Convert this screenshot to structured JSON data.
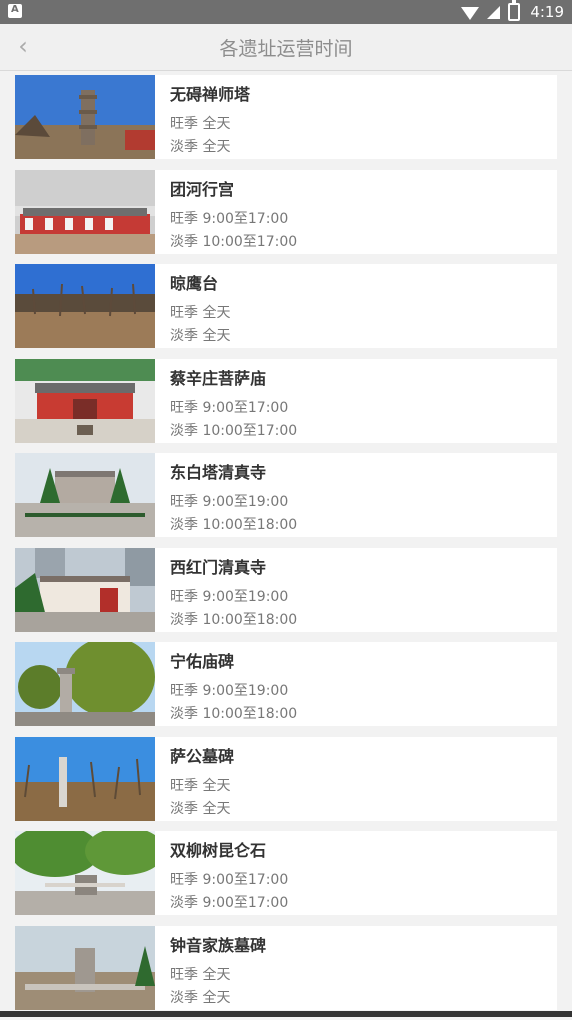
{
  "status_bar": {
    "left_icon": "A",
    "time": "4:19"
  },
  "header": {
    "title": "各遗址运营时间",
    "back_icon": "chevron-left-icon"
  },
  "sites": [
    {
      "name": "无碍禅师塔",
      "peak": "旺季 全天",
      "off": "淡季 全天"
    },
    {
      "name": "团河行宫",
      "peak": "旺季 9:00至17:00",
      "off": "淡季 10:00至17:00"
    },
    {
      "name": "晾鹰台",
      "peak": "旺季 全天",
      "off": "淡季 全天"
    },
    {
      "name": "蔡辛庄菩萨庙",
      "peak": "旺季 9:00至17:00",
      "off": "淡季 10:00至17:00"
    },
    {
      "name": "东白塔清真寺",
      "peak": "旺季 9:00至19:00",
      "off": "淡季 10:00至18:00"
    },
    {
      "name": "西红门清真寺",
      "peak": "旺季 9:00至19:00",
      "off": "淡季 10:00至18:00"
    },
    {
      "name": "宁佑庙碑",
      "peak": "旺季 9:00至19:00",
      "off": "淡季 10:00至18:00"
    },
    {
      "name": "萨公墓碑",
      "peak": "旺季 全天",
      "off": "淡季 全天"
    },
    {
      "name": "双柳树昆仑石",
      "peak": "旺季 9:00至17:00",
      "off": "淡季 9:00至17:00"
    },
    {
      "name": "钟音家族墓碑",
      "peak": "旺季 全天",
      "off": "淡季 全天"
    }
  ]
}
